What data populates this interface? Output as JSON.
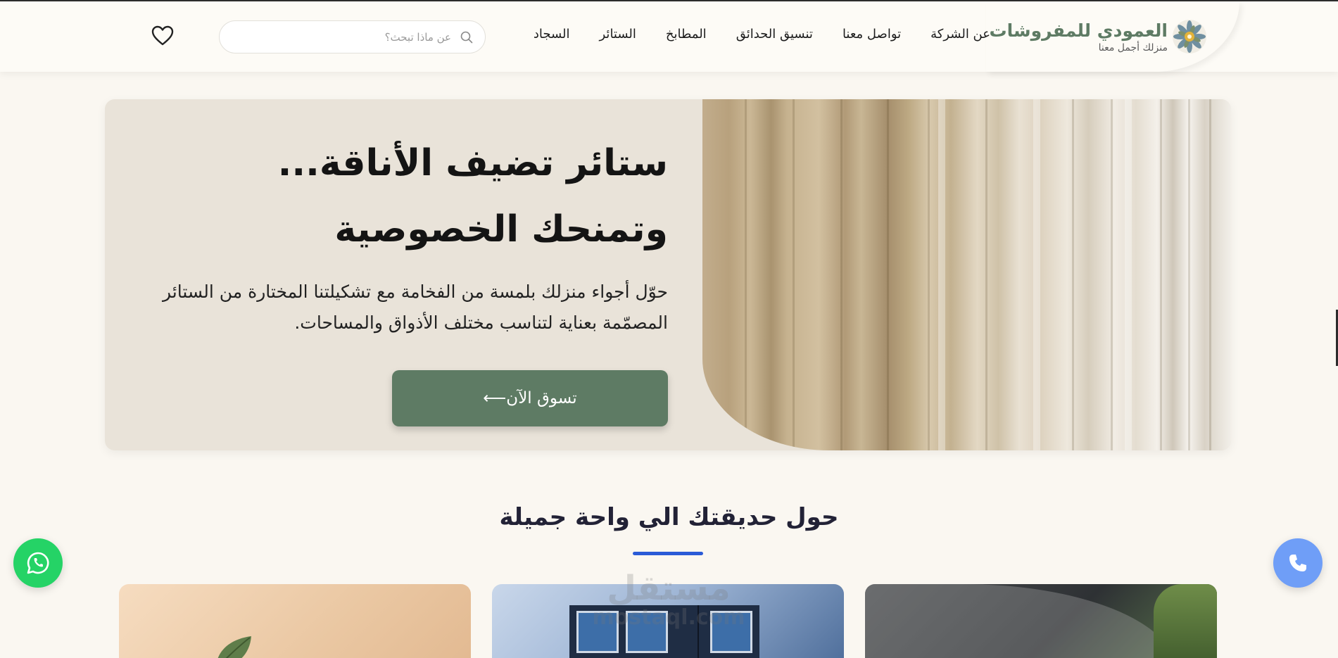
{
  "brand": {
    "name": "العمودي للمفروشات",
    "tagline": "منزلك أجمل معنا",
    "logo_icon": "mosaic-flower-icon"
  },
  "nav": {
    "items": [
      {
        "label": "السجاد"
      },
      {
        "label": "الستائر"
      },
      {
        "label": "المطابخ"
      },
      {
        "label": "تنسيق الحدائق"
      },
      {
        "label": "تواصل معنا"
      },
      {
        "label": "عن الشركة"
      }
    ]
  },
  "search": {
    "placeholder": "عن ماذا تبحث؟",
    "value": "",
    "icon": "search-icon"
  },
  "header": {
    "favorites_icon": "heart-icon"
  },
  "hero": {
    "title": "ستائر تضيف الأناقة... وتمنحك الخصوصية",
    "description": "حوّل أجواء منزلك بلمسة من الفخامة مع تشكيلتنا المختارة من الستائر المصمّمة بعناية لتناسب مختلف الأذواق والمساحات.",
    "cta_label": "تسوق الآن⟵",
    "image": "curtains-photo"
  },
  "section": {
    "title": "حول حديقتك الي واحة جميلة"
  },
  "watermark": {
    "arabic": "مستقل",
    "latin": "mostaql.com"
  },
  "floating": {
    "whatsapp_icon": "whatsapp-icon",
    "phone_icon": "phone-icon"
  },
  "colors": {
    "brand_green": "#5e7b64",
    "background": "#faf7f1",
    "hero_bg": "#e9e3d9",
    "accent_blue": "#2a5bd7",
    "whatsapp_green": "#25d366",
    "call_blue": "#6f9ef7"
  }
}
